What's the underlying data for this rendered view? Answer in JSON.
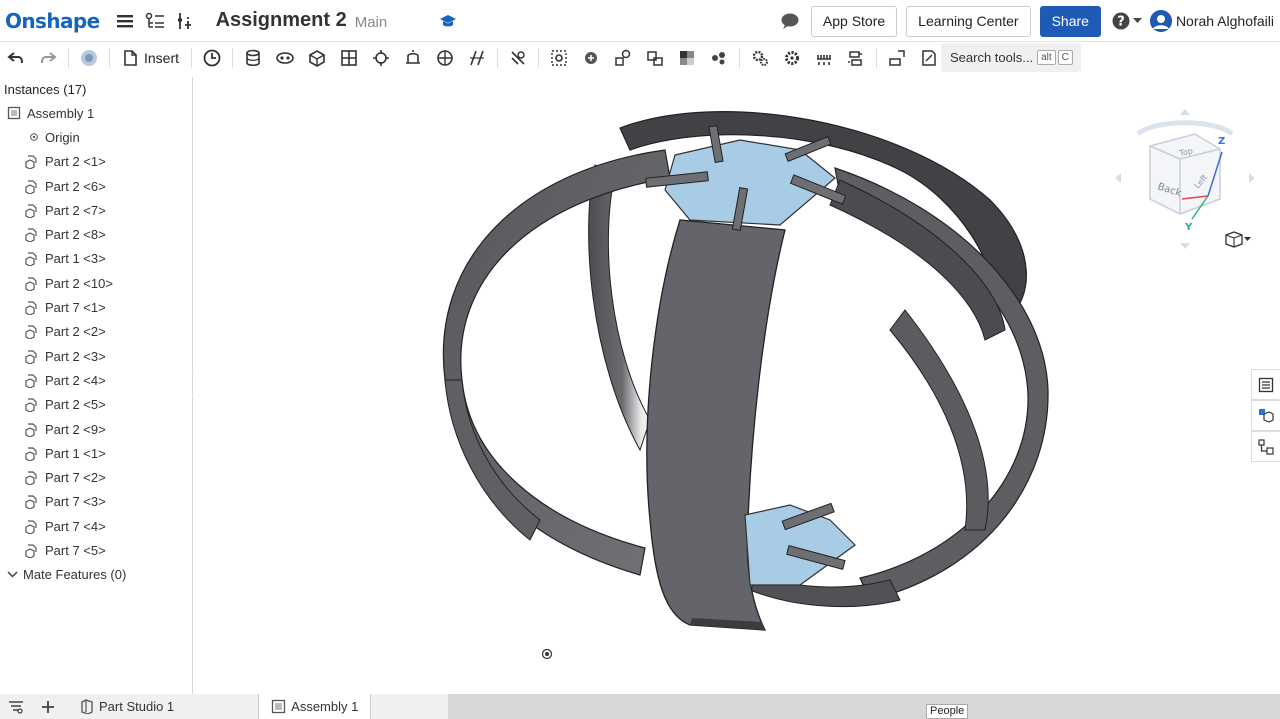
{
  "header": {
    "logo": "Onshape",
    "title": "Assignment 2",
    "branch": "Main",
    "app_store": "App Store",
    "learning_center": "Learning Center",
    "share": "Share",
    "user": "Norah Alghofaili"
  },
  "toolbar": {
    "insert": "Insert",
    "search_placeholder": "Search tools...",
    "shortcut_alt": "alt",
    "shortcut_key": "C"
  },
  "panel": {
    "title": "Instances (17)",
    "assembly": "Assembly 1",
    "origin": "Origin",
    "parts": [
      "Part 2 <1>",
      "Part 2 <6>",
      "Part 2 <7>",
      "Part 2 <8>",
      "Part 1 <3>",
      "Part 2 <10>",
      "Part 7 <1>",
      "Part 2 <2>",
      "Part 2 <3>",
      "Part 2 <4>",
      "Part 2 <5>",
      "Part 2 <9>",
      "Part 1 <1>",
      "Part 7 <2>",
      "Part 7 <3>",
      "Part 7 <4>",
      "Part 7 <5>"
    ],
    "mate_features": "Mate Features (0)"
  },
  "viewcube": {
    "face_back": "Back",
    "face_top": "Top",
    "face_left": "Left",
    "axis_z": "Z",
    "axis_y": "Y"
  },
  "tabs": {
    "part_studio": "Part Studio 1",
    "assembly": "Assembly 1"
  },
  "tooltip": "People",
  "colors": {
    "brand": "#1565c0",
    "share_button": "#1f5bb5",
    "ring": "#5a5c60",
    "plate": "#a8cbe6"
  }
}
